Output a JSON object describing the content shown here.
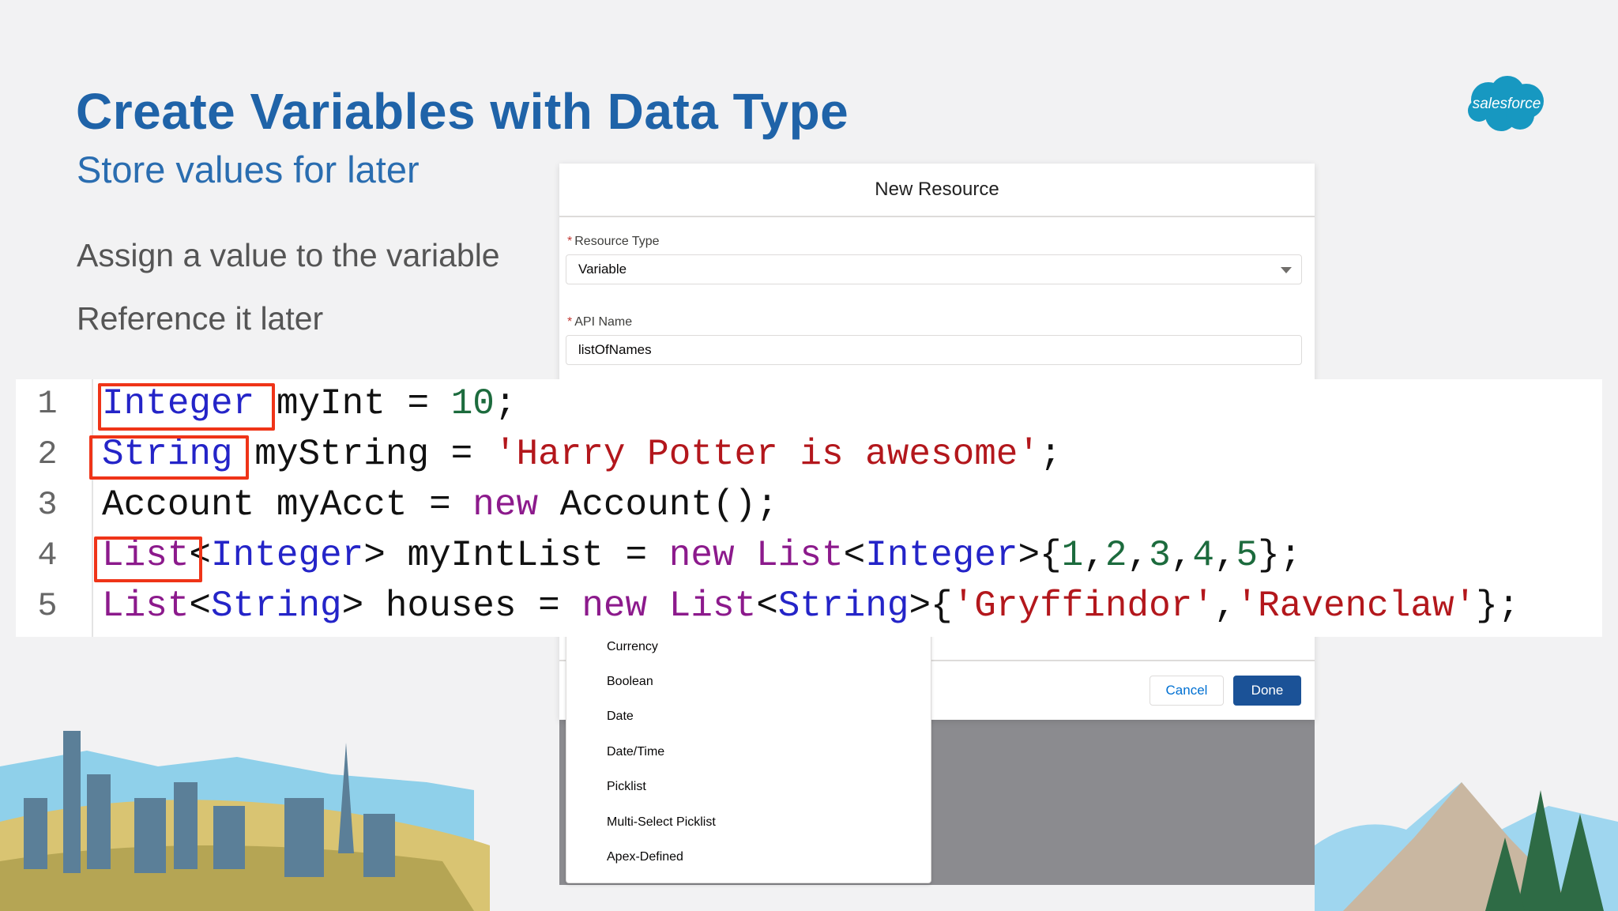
{
  "slide": {
    "title": "Create Variables with Data Type",
    "subtitle": "Store values for later",
    "bullets": [
      "Assign a value to the variable",
      "Reference it later"
    ],
    "logo_text": "salesforce"
  },
  "modal": {
    "title": "New Resource",
    "resource_type_label": "Resource Type",
    "resource_type_value": "Variable",
    "api_name_label": "API Name",
    "api_name_value": "listOfNames",
    "cancel_label": "Cancel",
    "done_label": "Done"
  },
  "dropdown": {
    "items": [
      "Currency",
      "Boolean",
      "Date",
      "Date/Time",
      "Picklist",
      "Multi-Select Picklist",
      "Apex-Defined"
    ]
  },
  "code": {
    "line_numbers": [
      "1",
      "2",
      "3",
      "4",
      "5"
    ],
    "lines": [
      [
        {
          "t": "Integer",
          "c": "kw-t"
        },
        {
          "t": " myInt = ",
          "c": ""
        },
        {
          "t": "10",
          "c": "num"
        },
        {
          "t": ";",
          "c": ""
        }
      ],
      [
        {
          "t": "String",
          "c": "kw-t"
        },
        {
          "t": " myString = ",
          "c": ""
        },
        {
          "t": "'Harry Potter is awesome'",
          "c": "str"
        },
        {
          "t": ";",
          "c": ""
        }
      ],
      [
        {
          "t": "Account myAcct = ",
          "c": ""
        },
        {
          "t": "new",
          "c": "kw-n"
        },
        {
          "t": " Account();",
          "c": ""
        }
      ],
      [
        {
          "t": "List",
          "c": "kw-n"
        },
        {
          "t": "<",
          "c": ""
        },
        {
          "t": "Integer",
          "c": "kw-t"
        },
        {
          "t": "> myIntList = ",
          "c": ""
        },
        {
          "t": "new",
          "c": "kw-n"
        },
        {
          "t": " ",
          "c": ""
        },
        {
          "t": "List",
          "c": "kw-n"
        },
        {
          "t": "<",
          "c": ""
        },
        {
          "t": "Integer",
          "c": "kw-t"
        },
        {
          "t": ">{",
          "c": ""
        },
        {
          "t": "1",
          "c": "num"
        },
        {
          "t": ",",
          "c": ""
        },
        {
          "t": "2",
          "c": "num"
        },
        {
          "t": ",",
          "c": ""
        },
        {
          "t": "3",
          "c": "num"
        },
        {
          "t": ",",
          "c": ""
        },
        {
          "t": "4",
          "c": "num"
        },
        {
          "t": ",",
          "c": ""
        },
        {
          "t": "5",
          "c": "num"
        },
        {
          "t": "};",
          "c": ""
        }
      ],
      [
        {
          "t": "List",
          "c": "kw-n"
        },
        {
          "t": "<",
          "c": ""
        },
        {
          "t": "String",
          "c": "kw-t"
        },
        {
          "t": "> houses = ",
          "c": ""
        },
        {
          "t": "new",
          "c": "kw-n"
        },
        {
          "t": " ",
          "c": ""
        },
        {
          "t": "List",
          "c": "kw-n"
        },
        {
          "t": "<",
          "c": ""
        },
        {
          "t": "String",
          "c": "kw-t"
        },
        {
          "t": ">{",
          "c": ""
        },
        {
          "t": "'Gryffindor'",
          "c": "str"
        },
        {
          "t": ",",
          "c": ""
        },
        {
          "t": "'Ravenclaw'",
          "c": "str"
        },
        {
          "t": "};",
          "c": ""
        }
      ]
    ]
  },
  "colors": {
    "title": "#1f63a8",
    "highlight_box": "#ef3418",
    "type_keyword": "#2424c8",
    "new_keyword": "#8c1a8c",
    "string_literal": "#b3171c",
    "number_literal": "#1c6b3d",
    "done_button": "#1b5297"
  }
}
